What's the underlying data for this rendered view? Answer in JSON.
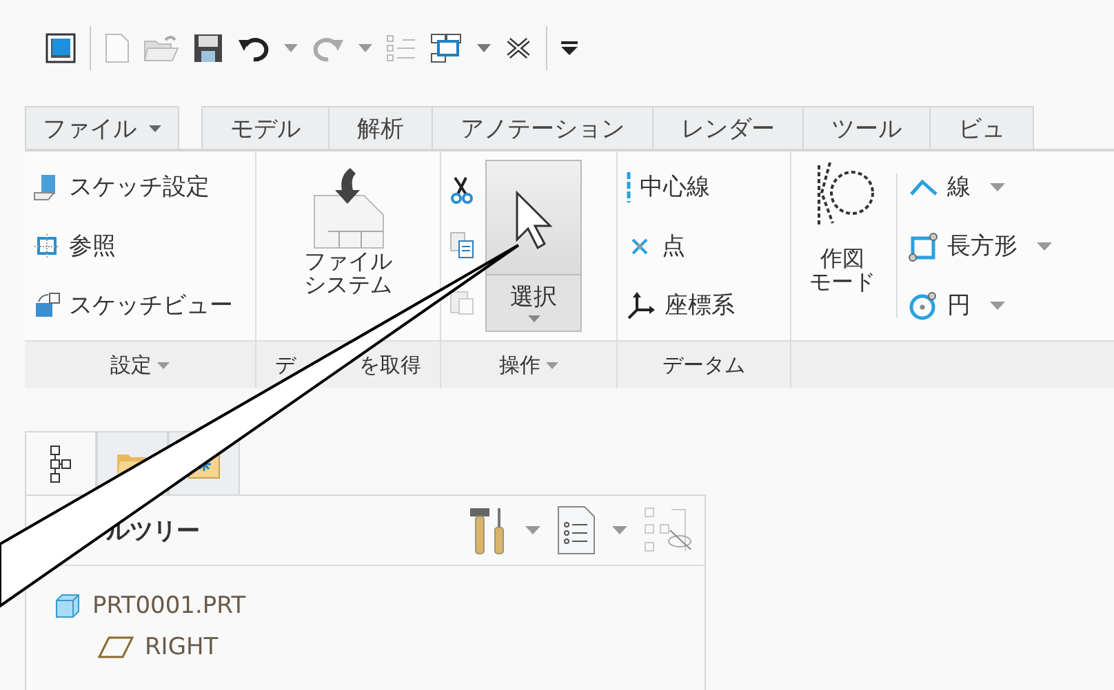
{
  "ribbon_tabs": [
    {
      "label": "ファイル",
      "dropdown": true,
      "selected": false
    },
    {
      "label": "モデル",
      "dropdown": false,
      "selected": false
    },
    {
      "label": "解析",
      "dropdown": false,
      "selected": false
    },
    {
      "label": "アノテーション",
      "dropdown": false,
      "selected": false
    },
    {
      "label": "レンダー",
      "dropdown": false,
      "selected": false
    },
    {
      "label": "ツール",
      "dropdown": false,
      "selected": false
    },
    {
      "label": "ビュ",
      "dropdown": false,
      "selected": false
    }
  ],
  "groups": [
    {
      "label": "設定",
      "dropdown": true,
      "items": [
        {
          "label": "スケッチ設定"
        },
        {
          "label": "参照"
        },
        {
          "label": "スケッチビュー"
        }
      ]
    },
    {
      "label_parts": [
        "デ",
        "を取得"
      ],
      "dropdown": false,
      "items": [
        {
          "label_lines": [
            "ファイル",
            "システム"
          ]
        }
      ]
    },
    {
      "label": "操作",
      "dropdown": true,
      "items": [
        {
          "label": "選択",
          "selected": true
        }
      ]
    },
    {
      "label": "データム",
      "dropdown": false,
      "items": [
        {
          "label": "中心線"
        },
        {
          "label": "点"
        },
        {
          "label": "座標系"
        }
      ]
    },
    {
      "items": [
        {
          "label_lines": [
            "作図",
            "モード"
          ]
        },
        {
          "label": "線",
          "dropdown": true
        },
        {
          "label": "長方形",
          "dropdown": true
        },
        {
          "label": "円",
          "dropdown": true
        }
      ]
    }
  ],
  "tree_tabs": [
    {
      "selected": true
    },
    {
      "selected": false
    },
    {
      "selected": false
    }
  ],
  "tree": {
    "title": "ルツリー",
    "items": [
      {
        "label": "PRT0001.PRT",
        "children": [
          {
            "label": "RIGHT"
          }
        ]
      }
    ]
  }
}
